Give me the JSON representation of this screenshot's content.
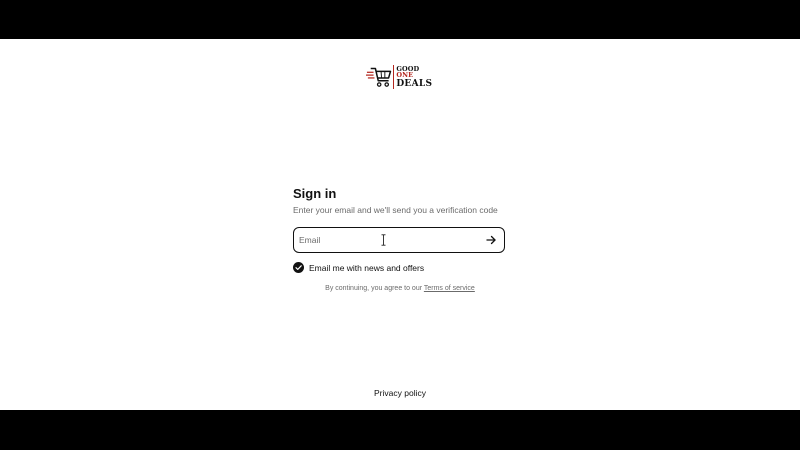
{
  "brand": {
    "line1_prefix": "GOOD ",
    "line1_accent": "ONE",
    "line2": "DEALS",
    "accent_color": "#b3261e"
  },
  "signin": {
    "title": "Sign in",
    "subtitle": "Enter your email and we'll send you a verification code",
    "email_placeholder": "Email",
    "email_value": "",
    "submit_icon": "arrow-right-icon",
    "newsletter": {
      "label": "Email me with news and offers",
      "checked": true
    },
    "terms_prefix": "By continuing, you agree to our ",
    "terms_link": "Terms of service"
  },
  "footer": {
    "privacy_link": "Privacy policy"
  }
}
